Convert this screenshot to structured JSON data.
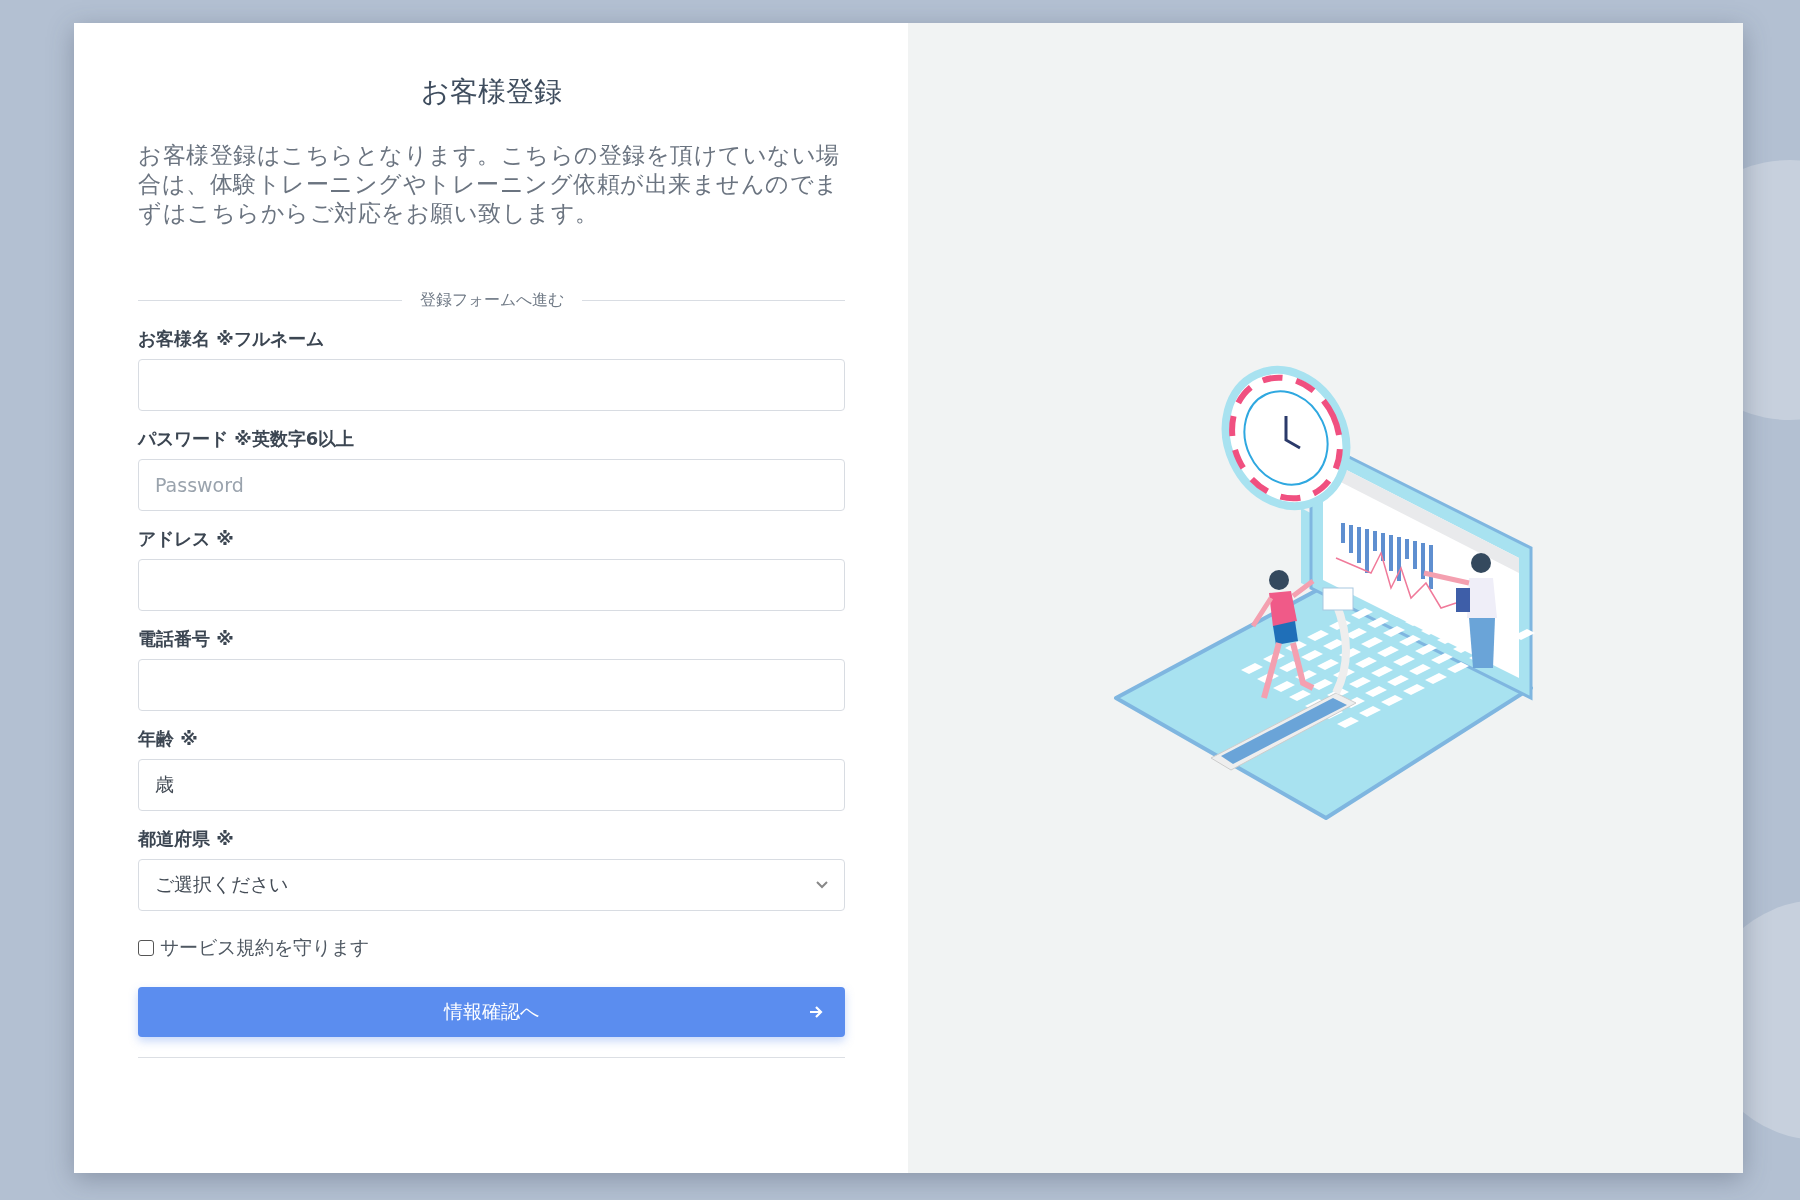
{
  "title": "お客様登録",
  "intro": "お客様登録はこちらとなります。こちらの登録を頂けていない場合は、体験トレーニングやトレーニング依頼が出来ませんのでまずはこちらからご対応をお願い致します。",
  "divider_label": "登録フォームへ進む",
  "fields": [
    {
      "kind": "text",
      "label": "お客様名 ※フルネーム"
    },
    {
      "kind": "password",
      "label": "パスワード ※英数字6以上",
      "placeholder": "Password"
    },
    {
      "kind": "text",
      "label": "アドレス ※"
    },
    {
      "kind": "text",
      "label": "電話番号 ※"
    },
    {
      "kind": "text",
      "label": "年齢 ※",
      "value": "歳"
    },
    {
      "kind": "select",
      "label": "都道府県 ※",
      "value": "ご選択ください"
    }
  ],
  "agreement": {
    "label": "サービス規約を守ります",
    "checked": false
  },
  "submit": {
    "label": "情報確認へ"
  }
}
